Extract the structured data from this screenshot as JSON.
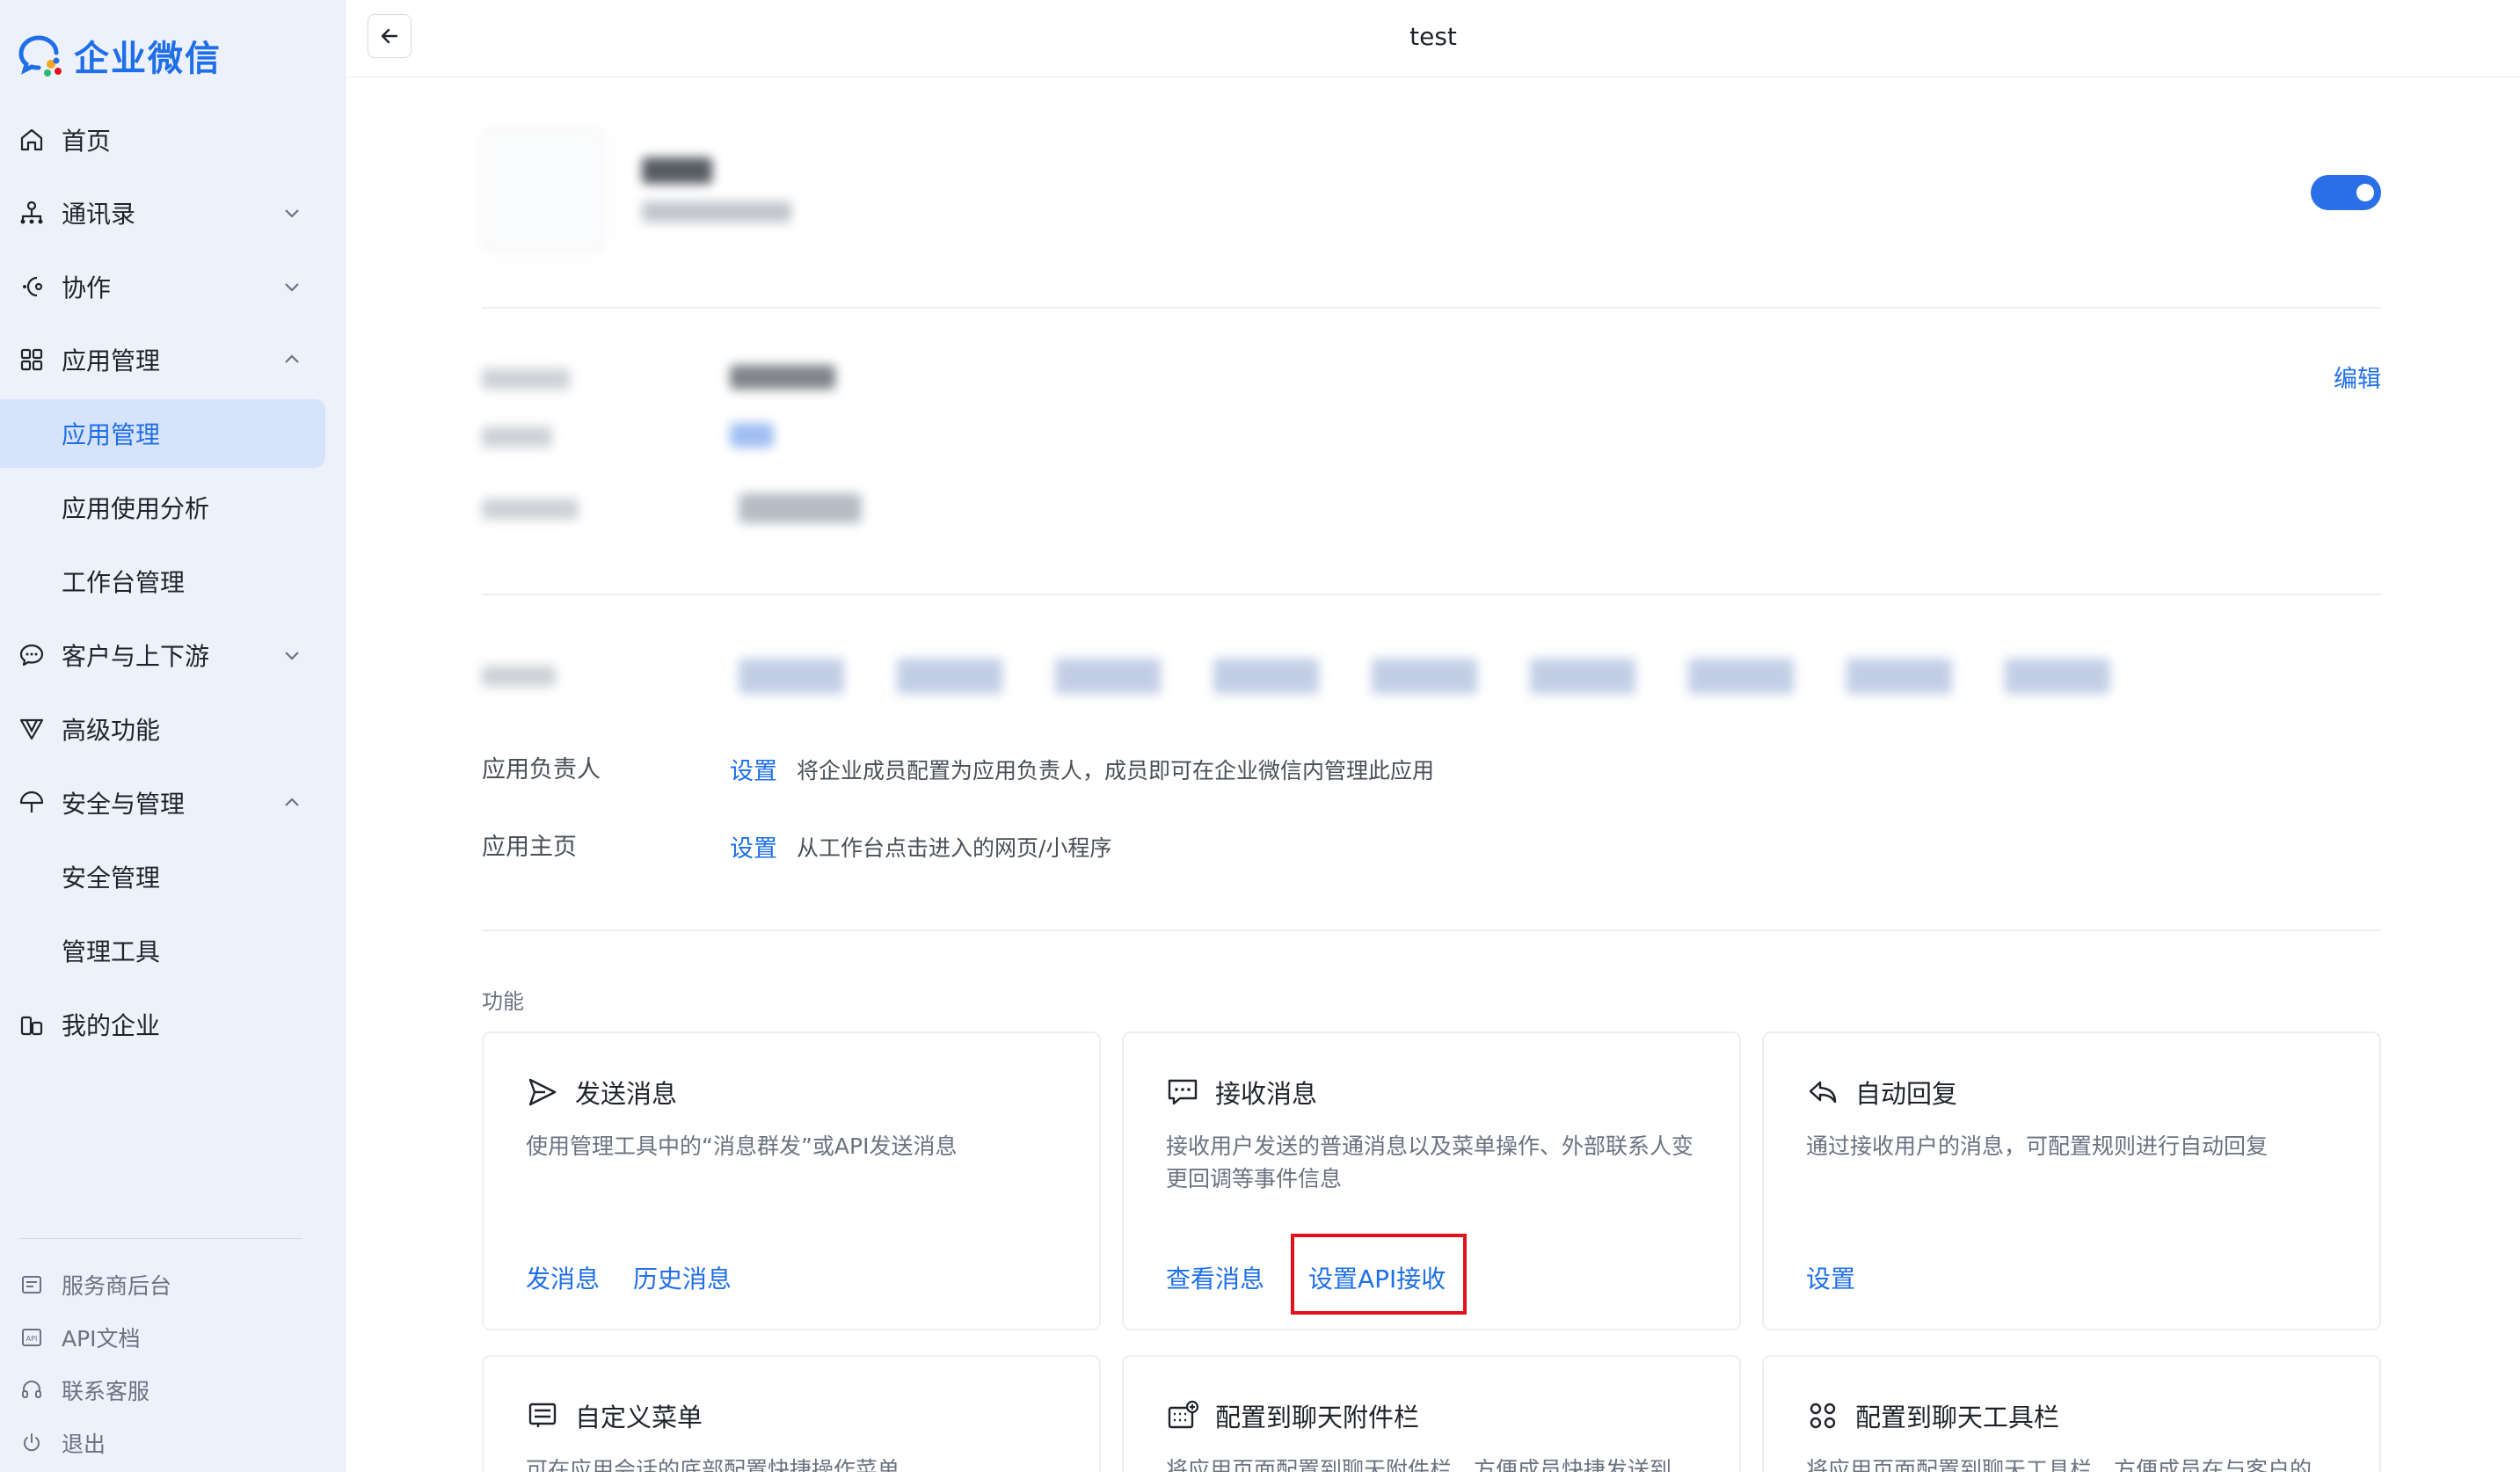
{
  "brand": {
    "name": "企业微信"
  },
  "sidebar": {
    "items": [
      {
        "label": "首页"
      },
      {
        "label": "通讯录"
      },
      {
        "label": "协作"
      },
      {
        "label": "应用管理"
      },
      {
        "label": "应用管理"
      },
      {
        "label": "应用使用分析"
      },
      {
        "label": "工作台管理"
      },
      {
        "label": "客户与上下游"
      },
      {
        "label": "高级功能"
      },
      {
        "label": "安全与管理"
      },
      {
        "label": "安全管理"
      },
      {
        "label": "管理工具"
      },
      {
        "label": "我的企业"
      }
    ],
    "footer": [
      {
        "label": "服务商后台"
      },
      {
        "label": "API文档"
      },
      {
        "label": "联系客服"
      },
      {
        "label": "退出"
      }
    ]
  },
  "header": {
    "title": "test"
  },
  "app": {
    "edit_label": "编辑",
    "owner": {
      "label": "应用负责人",
      "action": "设置",
      "desc": "将企业成员配置为应用负责人，成员即可在企业微信内管理此应用"
    },
    "homepage": {
      "label": "应用主页",
      "action": "设置",
      "desc": "从工作台点击进入的网页/小程序"
    }
  },
  "features": {
    "label": "功能",
    "cards": [
      {
        "title": "发送消息",
        "desc": "使用管理工具中的“消息群发”或API发送消息",
        "links": [
          "发消息",
          "历史消息"
        ]
      },
      {
        "title": "接收消息",
        "desc": "接收用户发送的普通消息以及菜单操作、外部联系人变更回调等事件信息",
        "links": [
          "查看消息",
          "设置API接收"
        ]
      },
      {
        "title": "自动回复",
        "desc": "通过接收用户的消息，可配置规则进行自动回复",
        "links": [
          "设置"
        ]
      },
      {
        "title": "自定义菜单",
        "desc": "可在应用会话的底部配置快捷操作菜单"
      },
      {
        "title": "配置到聊天附件栏",
        "desc": "将应用页面配置到聊天附件栏，方便成员快捷发送到"
      },
      {
        "title": "配置到聊天工具栏",
        "desc": "将应用页面配置到聊天工具栏，方便成员在与客户的"
      }
    ]
  },
  "colors": {
    "accent": "#1f6fe8",
    "highlight": "#e0131c",
    "sidebar_bg": "#edf1fb"
  }
}
